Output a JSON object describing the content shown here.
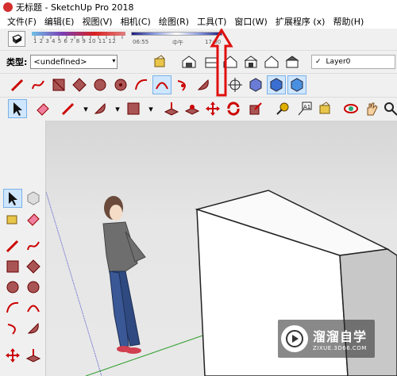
{
  "window": {
    "title": "无标题 - SketchUp Pro 2018"
  },
  "menu": [
    "文件(F)",
    "编辑(E)",
    "视图(V)",
    "相机(C)",
    "绘图(R)",
    "工具(T)",
    "窗口(W)",
    "扩展程序 (x)",
    "帮助(H)"
  ],
  "shadows": {
    "month_ticks": "1 2 3 4 5 6 7 8 9 10 11 12",
    "time_start": "06:55",
    "time_mid": "中午",
    "time_end": "17:00"
  },
  "entity_info": {
    "type_label": "类型:",
    "type_value": "<undefined>"
  },
  "layers": {
    "current": "Layer0"
  },
  "watermark": {
    "main": "溜溜自学",
    "sub": "ZIXUE.3D66.COM"
  },
  "colors": {
    "accent_red": "#e01010",
    "toolbar_bg": "#f0f0f0",
    "selected_tool": "#cfe6ff"
  }
}
